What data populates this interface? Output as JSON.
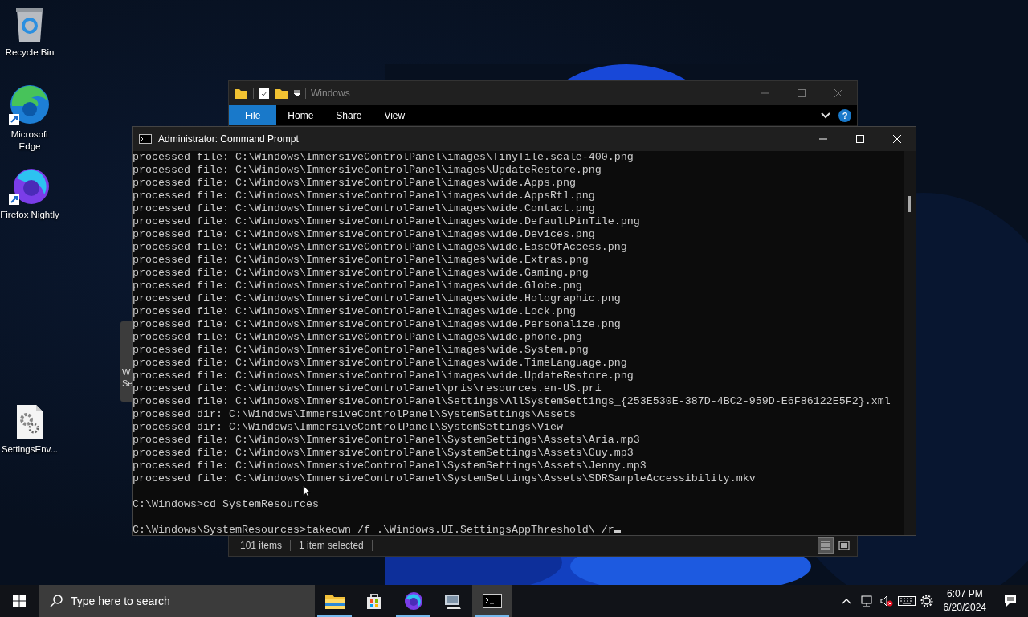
{
  "desktop_icons": [
    {
      "label": "Recycle Bin",
      "kind": "recycle-bin",
      "shortcut": false
    },
    {
      "label": "Microsoft Edge",
      "kind": "edge",
      "shortcut": true
    },
    {
      "label": "Firefox Nightly",
      "kind": "firefox",
      "shortcut": true
    },
    {
      "label": "SettingsEnv...",
      "kind": "settings-file",
      "shortcut": false
    }
  ],
  "side_panel": {
    "texts": [
      "W",
      "Se"
    ]
  },
  "explorer": {
    "title": "Windows",
    "tabs": [
      {
        "label": "File",
        "selected": true
      },
      {
        "label": "Home",
        "selected": false
      },
      {
        "label": "Share",
        "selected": false
      },
      {
        "label": "View",
        "selected": false
      }
    ],
    "help": "?",
    "status": {
      "items": "101 items",
      "selection": "1 item selected"
    },
    "views": [
      {
        "kind": "details",
        "selected": true
      },
      {
        "kind": "tiles",
        "selected": false
      }
    ]
  },
  "cmd": {
    "title": "Administrator: Command Prompt",
    "lines": [
      {
        "text": "processed file: C:\\Windows\\ImmersiveControlPanel\\images\\TinyTile.scale-400.png"
      },
      {
        "text": "processed file: C:\\Windows\\ImmersiveControlPanel\\images\\UpdateRestore.png"
      },
      {
        "text": "processed file: C:\\Windows\\ImmersiveControlPanel\\images\\wide.Apps.png"
      },
      {
        "text": "processed file: C:\\Windows\\ImmersiveControlPanel\\images\\wide.AppsRtl.png"
      },
      {
        "text": "processed file: C:\\Windows\\ImmersiveControlPanel\\images\\wide.Contact.png"
      },
      {
        "text": "processed file: C:\\Windows\\ImmersiveControlPanel\\images\\wide.DefaultPinTile.png"
      },
      {
        "text": "processed file: C:\\Windows\\ImmersiveControlPanel\\images\\wide.Devices.png"
      },
      {
        "text": "processed file: C:\\Windows\\ImmersiveControlPanel\\images\\wide.EaseOfAccess.png"
      },
      {
        "text": "processed file: C:\\Windows\\ImmersiveControlPanel\\images\\wide.Extras.png"
      },
      {
        "text": "processed file: C:\\Windows\\ImmersiveControlPanel\\images\\wide.Gaming.png"
      },
      {
        "text": "processed file: C:\\Windows\\ImmersiveControlPanel\\images\\wide.Globe.png"
      },
      {
        "text": "processed file: C:\\Windows\\ImmersiveControlPanel\\images\\wide.Holographic.png"
      },
      {
        "text": "processed file: C:\\Windows\\ImmersiveControlPanel\\images\\wide.Lock.png"
      },
      {
        "text": "processed file: C:\\Windows\\ImmersiveControlPanel\\images\\wide.Personalize.png"
      },
      {
        "text": "processed file: C:\\Windows\\ImmersiveControlPanel\\images\\wide.phone.png"
      },
      {
        "text": "processed file: C:\\Windows\\ImmersiveControlPanel\\images\\wide.System.png"
      },
      {
        "text": "processed file: C:\\Windows\\ImmersiveControlPanel\\images\\wide.TimeLanguage.png"
      },
      {
        "text": "processed file: C:\\Windows\\ImmersiveControlPanel\\images\\wide.UpdateRestore.png"
      },
      {
        "text": "processed file: C:\\Windows\\ImmersiveControlPanel\\pris\\resources.en-US.pri"
      },
      {
        "text": "processed file: C:\\Windows\\ImmersiveControlPanel\\Settings\\AllSystemSettings_{253E530E-387D-4BC2-959D-E6F86122E5F2}.xml"
      },
      {
        "text": "processed dir: C:\\Windows\\ImmersiveControlPanel\\SystemSettings\\Assets"
      },
      {
        "text": "processed dir: C:\\Windows\\ImmersiveControlPanel\\SystemSettings\\View"
      },
      {
        "text": "processed file: C:\\Windows\\ImmersiveControlPanel\\SystemSettings\\Assets\\Aria.mp3"
      },
      {
        "text": "processed file: C:\\Windows\\ImmersiveControlPanel\\SystemSettings\\Assets\\Guy.mp3"
      },
      {
        "text": "processed file: C:\\Windows\\ImmersiveControlPanel\\SystemSettings\\Assets\\Jenny.mp3"
      },
      {
        "text": "processed file: C:\\Windows\\ImmersiveControlPanel\\SystemSettings\\Assets\\SDRSampleAccessibility.mkv"
      },
      {
        "text": "C:\\Windows>cd SystemResources",
        "gap_before": true
      },
      {
        "text": "C:\\Windows\\SystemResources>takeown /f .\\Windows.UI.SettingsAppThreshold\\ /r",
        "gap_before": true,
        "cursor": true
      }
    ]
  },
  "taskbar": {
    "search_label": "Type here to search",
    "apps": [
      {
        "kind": "file-explorer",
        "running": true,
        "selected": false
      },
      {
        "kind": "store",
        "running": false,
        "selected": false
      },
      {
        "kind": "firefox",
        "running": true,
        "selected": false
      },
      {
        "kind": "control-panel",
        "running": false,
        "selected": false
      },
      {
        "kind": "terminal",
        "running": true,
        "selected": true
      }
    ],
    "volume_muted": true,
    "time": "6:07 PM",
    "date": "6/20/2024"
  }
}
